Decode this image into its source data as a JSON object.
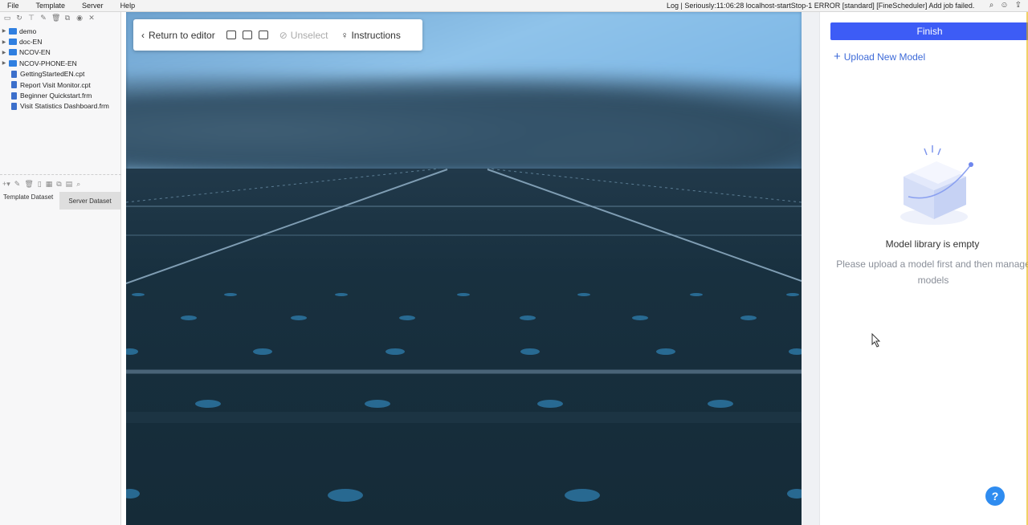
{
  "menubar": {
    "menus": [
      "File",
      "Template",
      "Server",
      "Help"
    ],
    "log_text": "Log | Seriously:11:06:28 localhost-startStop-1 ERROR [standard] [FineScheduler] Add job failed."
  },
  "left_panel": {
    "toolbar_icons": [
      "new-icon",
      "refresh-icon",
      "filter-icon",
      "edit-icon",
      "delete-icon",
      "copy-icon",
      "locate-icon",
      "close-icon"
    ],
    "tree": [
      {
        "type": "folder",
        "label": "demo"
      },
      {
        "type": "folder",
        "label": "doc-EN"
      },
      {
        "type": "folder",
        "label": "NCOV-EN"
      },
      {
        "type": "folder",
        "label": "NCOV-PHONE-EN"
      },
      {
        "type": "file",
        "label": "GettingStartedEN.cpt"
      },
      {
        "type": "file",
        "label": "Report Visit Monitor.cpt"
      },
      {
        "type": "file",
        "label": "Beginner Quickstart.frm"
      },
      {
        "type": "file",
        "label": "Visit Statistics Dashboard.frm"
      }
    ],
    "tabs": {
      "template_dataset": "Template Dataset",
      "server_dataset": "Server Dataset"
    }
  },
  "editor_bar": {
    "return_label": "Return to editor",
    "unselect_label": "Unselect",
    "instructions_label": "Instructions"
  },
  "right_panel": {
    "finish_label": "Finish",
    "upload_label": "Upload New Model",
    "empty_title": "Model library is empty",
    "empty_desc": "Please upload a model first and then manage models",
    "help_label": "?"
  },
  "colors": {
    "accent": "#3d5cf6",
    "link": "#3d6ad8",
    "help": "#2f8cf0"
  }
}
